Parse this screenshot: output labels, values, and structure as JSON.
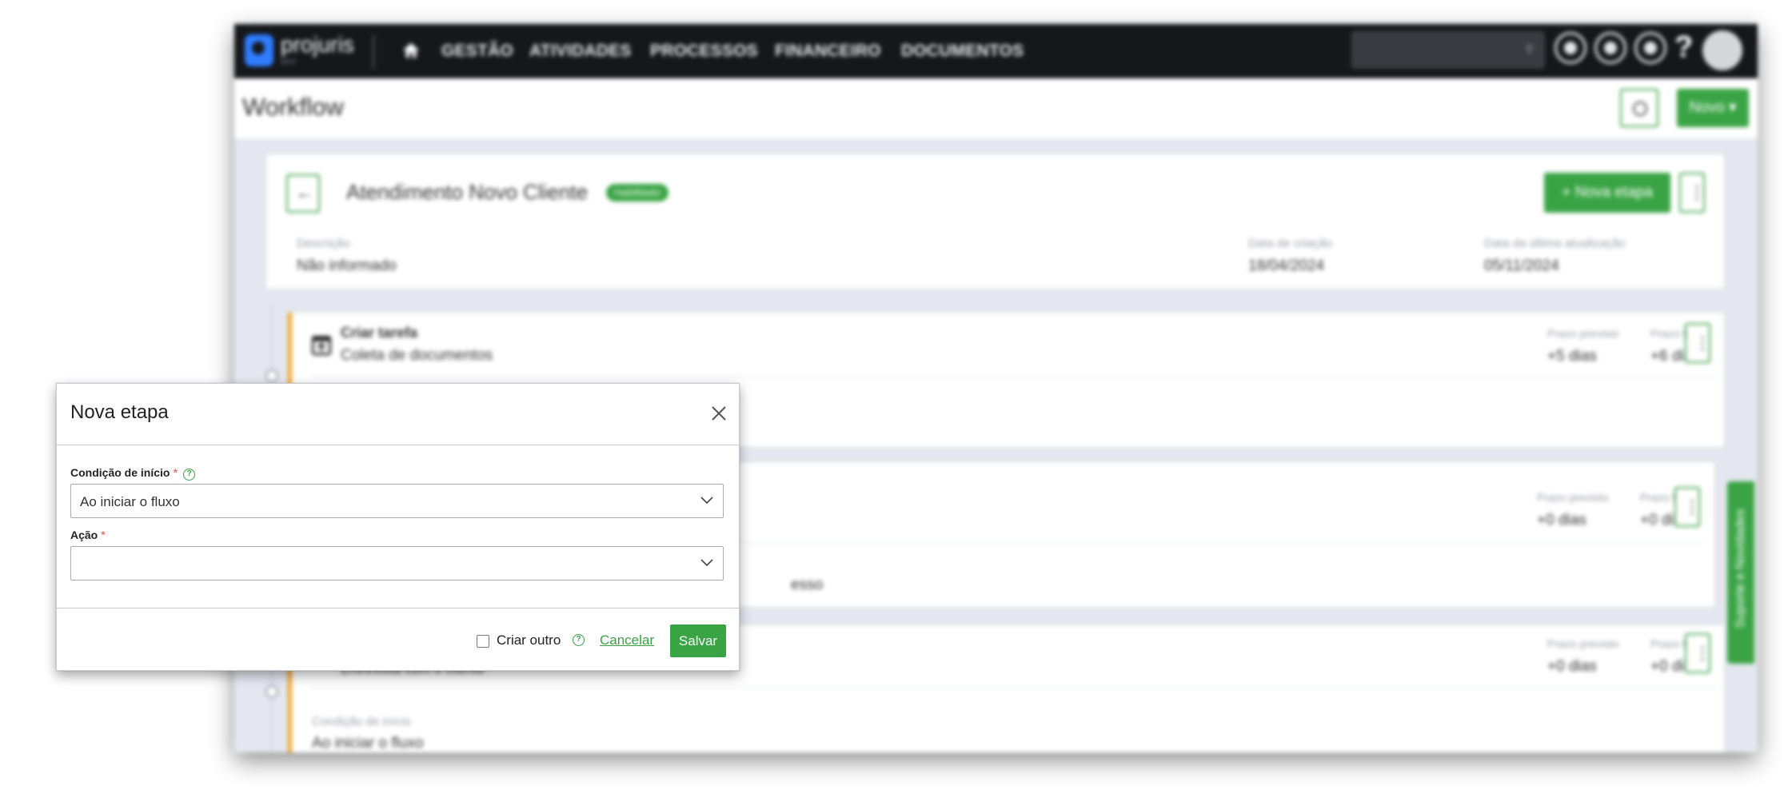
{
  "app": {
    "logo_text": "projuris",
    "logo_sub": "ADV",
    "nav": [
      "GESTÃO",
      "ATIVIDADES",
      "PROCESSOS",
      "FINANCEIRO",
      "DOCUMENTOS"
    ],
    "help_label": "?"
  },
  "page": {
    "title": "Workflow",
    "novo_label": "Novo ▾"
  },
  "workflow": {
    "back_label": "←",
    "name": "Atendimento Novo Cliente",
    "status": "Habilitado",
    "nova_etapa_label": "+ Nova etapa",
    "description_label": "Descrição",
    "description_value": "Não informado",
    "created_label": "Data de criação",
    "created_value": "18/04/2024",
    "updated_label": "Data da última atualização",
    "updated_value": "05/11/2024"
  },
  "steps": [
    {
      "type": "Criar tarefa",
      "name": "Coleta de documentos",
      "prazo_previsto_label": "Prazo previsto",
      "prazo_previsto": "+5 dias",
      "prazo_fatal_label": "Prazo fatal",
      "prazo_fatal": "+6 dias"
    },
    {
      "fragment": "esso",
      "prazo_previsto_label": "Prazo previsto",
      "prazo_previsto": "+0 dias",
      "prazo_fatal_label": "Prazo fatal",
      "prazo_fatal": "+0 dias"
    },
    {
      "name": "Entrevista com o cliente",
      "prazo_previsto_label": "Prazo previsto",
      "prazo_previsto": "+0 dias",
      "prazo_fatal_label": "Prazo fatal",
      "prazo_fatal": "+0 dias",
      "condition_label": "Condição de início",
      "condition_value": "Ao iniciar o fluxo"
    }
  ],
  "side_tab": "Suporte e Novidades",
  "modal": {
    "title": "Nova etapa",
    "condition_label": "Condição de início",
    "condition_required": "*",
    "condition_help": "?",
    "condition_value": "Ao iniciar o fluxo",
    "action_label": "Ação",
    "action_required": "*",
    "action_value": "",
    "criar_outro_label": "Criar outro",
    "criar_outro_help": "?",
    "criar_outro_checked": false,
    "cancel_label": "Cancelar",
    "save_label": "Salvar"
  },
  "colors": {
    "accent": "#3aa445",
    "topbar": "#16171b",
    "step_bar": "#f3a623",
    "required": "#e05a4f"
  }
}
